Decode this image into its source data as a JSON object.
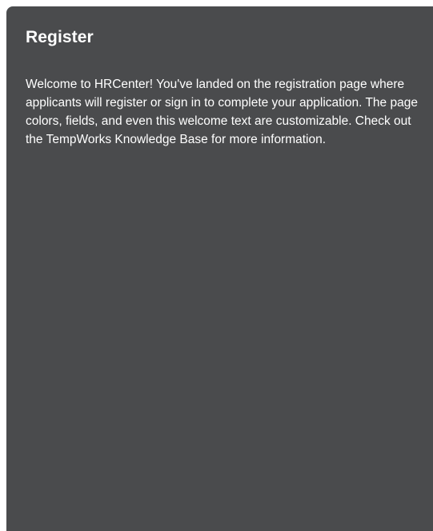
{
  "register": {
    "title": "Register",
    "welcome_text": "Welcome to HRCenter! You've landed on the registration page where applicants will register or sign in to complete your application. The page colors, fields, and even this welcome text are customizable. Check out the TempWorks Knowledge Base for more information."
  },
  "colors": {
    "panel_background": "#4a4b4d",
    "page_background": "#ffffff",
    "text": "#ffffff"
  }
}
